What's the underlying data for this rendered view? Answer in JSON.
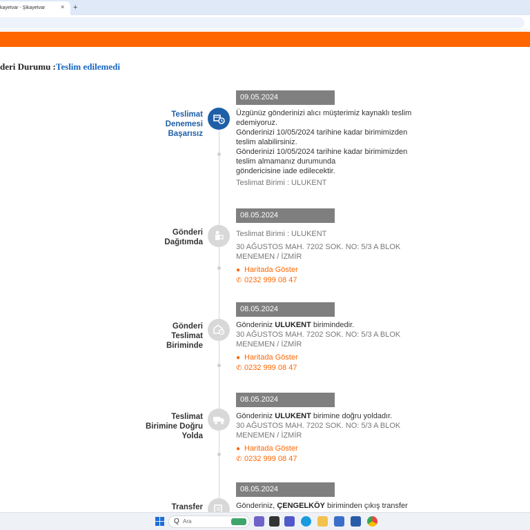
{
  "browser": {
    "tab_title": "kayetvar - Şikayetvar",
    "tab_close": "×",
    "new_tab": "+"
  },
  "status": {
    "label": "deri Durumu :",
    "value": "Teslim edilemedi"
  },
  "timeline": [
    {
      "title": [
        "Teslimat",
        "Denemesi",
        "Başarısız"
      ],
      "date": "09.05.2024",
      "icon": "package-clock-icon",
      "lines": [
        "Üzgünüz gönderinizi alıcı müşterimiz kaynaklı teslim",
        "edemiyoruz.",
        "Gönderinizi 10/05/2024 tarihine kadar birimimizden",
        "teslim alabilirsiniz.",
        "Gönderinizi 10/05/2024 tarihine kadar birimimizden",
        "teslim almamanız durumunda",
        "göndericisine iade edilecektir."
      ],
      "unit": "Teslimat Birimi : ULUKENT"
    },
    {
      "title": [
        "Gönderi",
        "Dağıtımda"
      ],
      "date": "08.05.2024",
      "icon": "courier-icon",
      "unit": "Teslimat Birimi : ULUKENT",
      "address": [
        "30 AĞUSTOS MAH. 7202 SOK. NO: 5/3  A BLOK",
        "MENEMEN / İZMİR"
      ],
      "map_link": "Haritada Göster",
      "phone": "0232 999 08 47"
    },
    {
      "title": [
        "Gönderi",
        "Teslimat",
        "Biriminde"
      ],
      "date": "08.05.2024",
      "icon": "branch-icon",
      "msg_before": "Gönderiniz ",
      "msg_bold": "ULUKENT",
      "msg_after": " birimindedir.",
      "address": [
        "30 AĞUSTOS MAH. 7202 SOK. NO: 5/3  A BLOK",
        "MENEMEN / İZMİR"
      ],
      "map_link": "Haritada Göster",
      "phone": "0232 999 08 47"
    },
    {
      "title": [
        "Teslimat",
        "Birimine Doğru",
        "Yolda"
      ],
      "date": "08.05.2024",
      "icon": "truck-icon",
      "msg_before": "Gönderiniz ",
      "msg_bold": "ULUKENT",
      "msg_after": " birimine doğru yoldadır.",
      "address": [
        "30 AĞUSTOS MAH. 7202 SOK. NO: 5/3  A BLOK",
        "MENEMEN / İZMİR"
      ],
      "map_link": "Haritada Göster",
      "phone": "0232 999 08 47"
    },
    {
      "title": [
        "Transfer"
      ],
      "date": "08.05.2024",
      "icon": "transfer-icon",
      "msg_before": "Gönderiniz, ",
      "msg_bold": "ÇENGELKÖY",
      "msg_after": " biriminden çıkış transfer"
    }
  ],
  "taskbar": {
    "search_icon": "Q",
    "search_placeholder": "Ara"
  },
  "colors": {
    "brand_orange": "#ff6600",
    "active_blue": "#1f5fa8",
    "date_gray": "#7f7f7f"
  }
}
